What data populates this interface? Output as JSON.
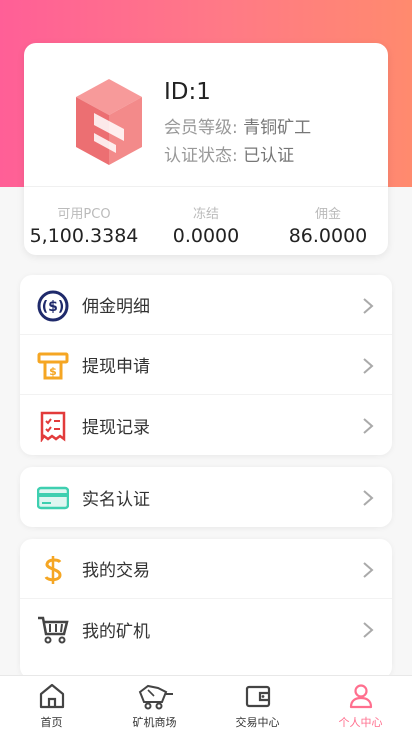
{
  "profile": {
    "id_text": "ID:1",
    "level_label": "会员等级:",
    "level_value": "青铜矿工",
    "status_label": "认证状态:",
    "status_value": "已认证",
    "stats": [
      {
        "label": "可用PCO",
        "value": "5,100.3384"
      },
      {
        "label": "冻结",
        "value": "0.0000"
      },
      {
        "label": "佣金",
        "value": "86.0000"
      }
    ]
  },
  "menu1": [
    {
      "label": "佣金明细",
      "icon": "dollar-circle-icon"
    },
    {
      "label": "提现申请",
      "icon": "withdraw-icon"
    },
    {
      "label": "提现记录",
      "icon": "receipt-icon"
    }
  ],
  "menu2": [
    {
      "label": "实名认证",
      "icon": "id-card-icon"
    }
  ],
  "menu3": [
    {
      "label": "我的交易",
      "icon": "dollar-sign-icon"
    },
    {
      "label": "我的矿机",
      "icon": "cart-icon"
    }
  ],
  "tabs": [
    {
      "label": "首页",
      "icon": "home-icon"
    },
    {
      "label": "矿机商场",
      "icon": "mine-cart-icon"
    },
    {
      "label": "交易中心",
      "icon": "wallet-icon"
    },
    {
      "label": "个人中心",
      "icon": "user-icon",
      "active": true
    }
  ],
  "colors": {
    "accent": "#ff6f8e",
    "gradient_start": "#ff5f97",
    "gradient_end": "#ff8a6e"
  }
}
